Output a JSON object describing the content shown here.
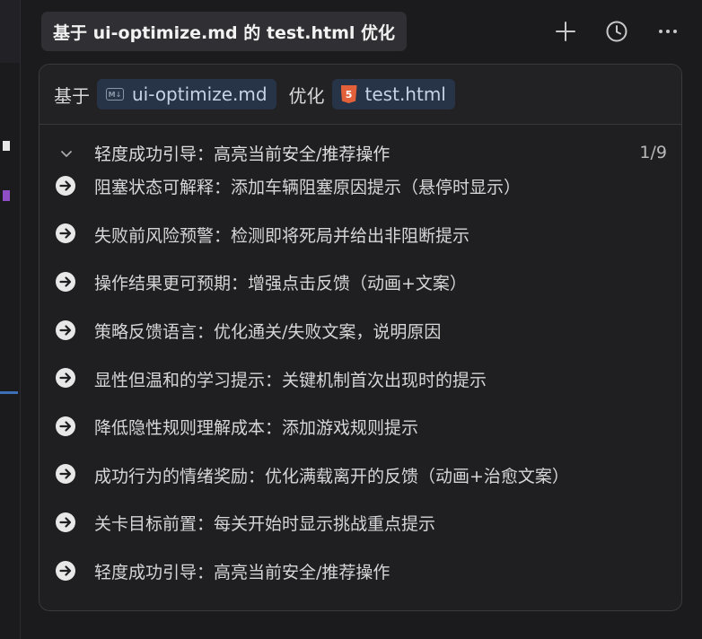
{
  "header": {
    "title": "基于 ui-optimize.md 的 test.html 优化",
    "icons": [
      "plus-icon",
      "clock-icon",
      "more-icon"
    ]
  },
  "context": {
    "prefix": "基于",
    "source_file": "ui-optimize.md",
    "middle": "优化",
    "target_file": "test.html"
  },
  "list": {
    "current": "轻度成功引导：高亮当前安全/推荐操作",
    "counter": "1/9",
    "items": [
      "阻塞状态可解释：添加车辆阻塞原因提示（悬停时显示）",
      "失败前风险预警：检测即将死局并给出非阻断提示",
      "操作结果更可预期：增强点击反馈（动画+文案）",
      "策略反馈语言：优化通关/失败文案，说明原因",
      "显性但温和的学习提示：关键机制首次出现时的提示",
      "降低隐性规则理解成本：添加游戏规则提示",
      "成功行为的情绪奖励：优化满载离开的反馈（动画+治愈文案）",
      "关卡目标前置：每关开始时显示挑战重点提示",
      "轻度成功引导：高亮当前安全/推荐操作"
    ]
  },
  "colors": {
    "background": "#1b1b1d",
    "chip": "#273447",
    "html5": "#e2603a",
    "accent_purple": "#8e4fc6",
    "accent_blue": "#3d6fb6"
  }
}
